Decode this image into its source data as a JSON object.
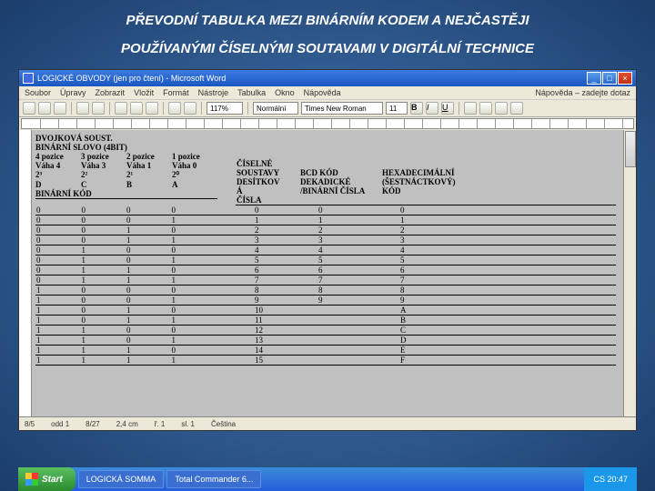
{
  "slide": {
    "line1": "PŘEVODNÍ TABULKA MEZI BINÁRNÍM KODEM A NEJČASTĚJI",
    "line2": "POUŽÍVANÝMI ČÍSELNÝMI SOUTAVAMI V DIGITÁLNÍ TECHNICE"
  },
  "win": {
    "title": "LOGICKÉ OBVODY (jen pro čtení) - Microsoft Word",
    "min": "_",
    "max": "□",
    "close": "×"
  },
  "menu": [
    "Soubor",
    "Úpravy",
    "Zobrazit",
    "Vložit",
    "Formát",
    "Nástroje",
    "Tabulka",
    "Okno",
    "Nápověda"
  ],
  "ask": "Nápověda – zadejte dotaz",
  "tb": {
    "style": "Normální",
    "font": "Times New Roman",
    "size": "11",
    "zoom": "117%"
  },
  "binhdr": {
    "t1": "DVOJKOVÁ SOUST.",
    "t2": "BINÁRNÍ SLOVO (4BIT)",
    "pos": [
      "4 pozice",
      "3 pozice",
      "2 pozice",
      "1 pozice"
    ],
    "vaha": [
      "Váha 4",
      "Váha 3",
      "Váha 1",
      "Váha 0"
    ],
    "exp": [
      "2³",
      "2²",
      "2¹",
      "2⁰"
    ],
    "dcba": [
      "D",
      "C",
      "B",
      "A"
    ],
    "bk": "BINÁRNÍ KÓD"
  },
  "numhdr": {
    "top": "ČÍSELNÉ SOUSTAVY",
    "dec1": "A",
    "dec2": "DESÍTKOV",
    "dec3": "Á",
    "dec4": "ČÍSLA",
    "bcd1": "BCD KÓD",
    "bcd2": "DEKADICKÉ",
    "bcd3": "/BINÁRNÍ ČÍSLA",
    "hex1": "HEXADECIMÁLNÍ",
    "hex2": "(ŠESTNÁCTKOVÝ)",
    "hex3": "KÓD"
  },
  "rows": [
    {
      "b": [
        "0",
        "0",
        "0",
        "0"
      ],
      "d": "0",
      "c": "0",
      "h": "0"
    },
    {
      "b": [
        "0",
        "0",
        "0",
        "1"
      ],
      "d": "1",
      "c": "1",
      "h": "1"
    },
    {
      "b": [
        "0",
        "0",
        "1",
        "0"
      ],
      "d": "2",
      "c": "2",
      "h": "2"
    },
    {
      "b": [
        "0",
        "0",
        "1",
        "1"
      ],
      "d": "3",
      "c": "3",
      "h": "3"
    },
    {
      "b": [
        "0",
        "1",
        "0",
        "0"
      ],
      "d": "4",
      "c": "4",
      "h": "4"
    },
    {
      "b": [
        "0",
        "1",
        "0",
        "1"
      ],
      "d": "5",
      "c": "5",
      "h": "5"
    },
    {
      "b": [
        "0",
        "1",
        "1",
        "0"
      ],
      "d": "6",
      "c": "6",
      "h": "6"
    },
    {
      "b": [
        "0",
        "1",
        "1",
        "1"
      ],
      "d": "7",
      "c": "7",
      "h": "7"
    },
    {
      "b": [
        "1",
        "0",
        "0",
        "0"
      ],
      "d": "8",
      "c": "8",
      "h": "8"
    },
    {
      "b": [
        "1",
        "0",
        "0",
        "1"
      ],
      "d": "9",
      "c": "9",
      "h": "9"
    },
    {
      "b": [
        "1",
        "0",
        "1",
        "0"
      ],
      "d": "10",
      "c": "",
      "h": "A"
    },
    {
      "b": [
        "1",
        "0",
        "1",
        "1"
      ],
      "d": "11",
      "c": "",
      "h": "B"
    },
    {
      "b": [
        "1",
        "1",
        "0",
        "0"
      ],
      "d": "12",
      "c": "",
      "h": "C"
    },
    {
      "b": [
        "1",
        "1",
        "0",
        "1"
      ],
      "d": "13",
      "c": "",
      "h": "D"
    },
    {
      "b": [
        "1",
        "1",
        "1",
        "0"
      ],
      "d": "14",
      "c": "",
      "h": "E"
    },
    {
      "b": [
        "1",
        "1",
        "1",
        "1"
      ],
      "d": "15",
      "c": "",
      "h": "F"
    }
  ],
  "status": {
    "page": "8/5",
    "sec": "odd 1",
    "pages": "8/27",
    "at": "2,4 cm",
    "ln": "ř. 1",
    "col": "sl. 1",
    "lang": "Čeština"
  },
  "task": {
    "start": "Start",
    "items": [
      "",
      "LOGICKÁ SOMMA",
      "Total Commander 6..."
    ],
    "tray": "CS 20:47"
  }
}
